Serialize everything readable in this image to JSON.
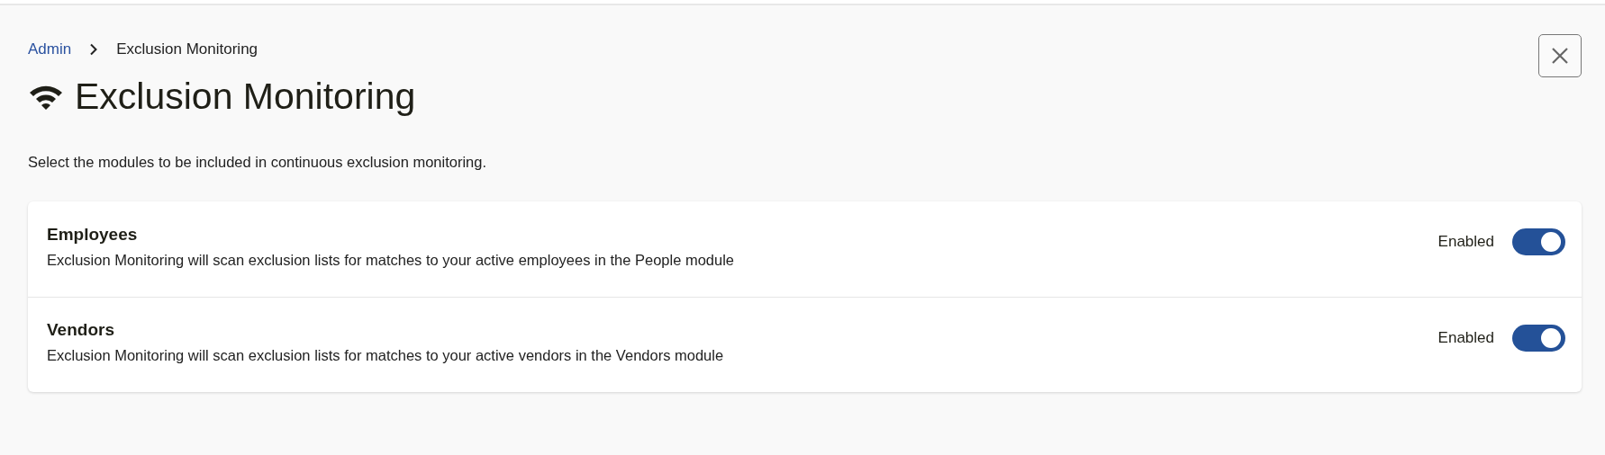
{
  "breadcrumb": [
    {
      "label": "Admin",
      "link": true
    },
    {
      "label": "Exclusion Monitoring",
      "link": false
    }
  ],
  "title": "Exclusion Monitoring",
  "description": "Select the modules to be included in continuous exclusion monitoring.",
  "modules": [
    {
      "name": "Employees",
      "description": "Exclusion Monitoring will scan exclusion lists for matches to your active employees in the People module",
      "status": "Enabled",
      "on": true
    },
    {
      "name": "Vendors",
      "description": "Exclusion Monitoring will scan exclusion lists for matches to your active vendors in the Vendors module",
      "status": "Enabled",
      "on": true
    }
  ]
}
